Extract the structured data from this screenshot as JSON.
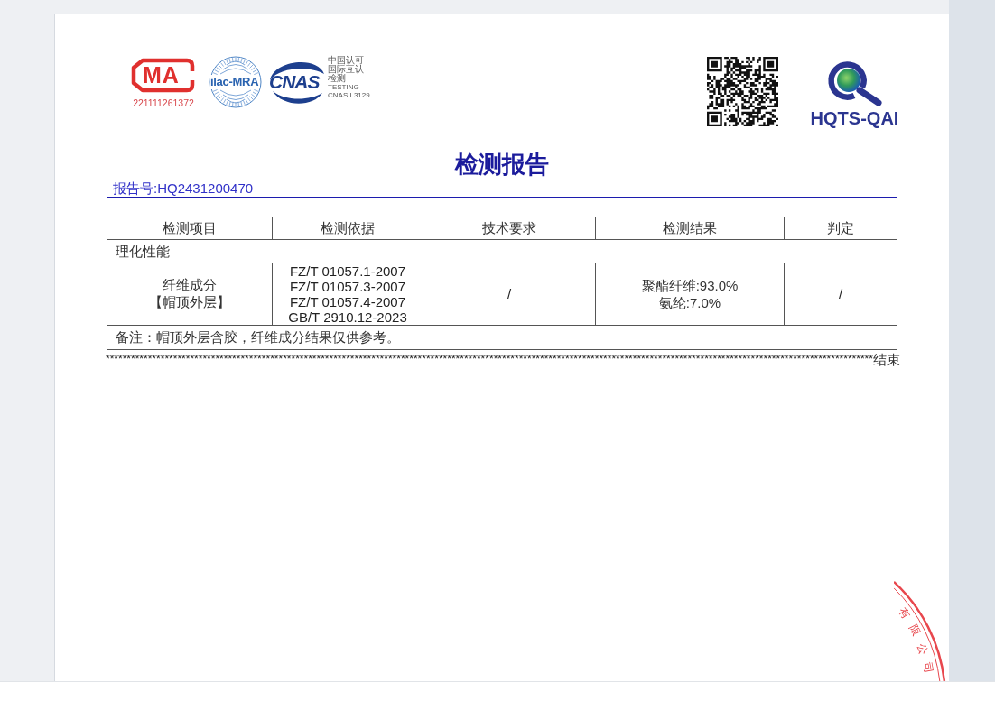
{
  "header": {
    "cma": {
      "mark": "MA",
      "number": "221111261372"
    },
    "ilac": {
      "mark": "ilac-MRA"
    },
    "cnas": {
      "mark": "CNAS",
      "caption_cn": [
        "中国认可",
        "国际互认",
        "检测"
      ],
      "caption_en": [
        "TESTING",
        "CNAS L3129"
      ]
    },
    "hqts": {
      "name": "HQTS-QAI"
    }
  },
  "title": "检测报告",
  "report_number": "报告号:HQ2431200470",
  "table": {
    "columns": [
      "检测项目",
      "检测依据",
      "技术要求",
      "检测结果",
      "判定"
    ],
    "section": "理化性能",
    "rows": [
      {
        "item": [
          "纤维成分",
          "【帽顶外层】"
        ],
        "basis": [
          "FZ/T 01057.1-2007",
          "FZ/T 01057.3-2007",
          "FZ/T 01057.4-2007",
          "GB/T 2910.12-2023"
        ],
        "requirement": "/",
        "result": [
          "聚酯纤维:93.0%",
          "氨纶:7.0%"
        ],
        "verdict": "/"
      }
    ],
    "remark": "备注：帽顶外层含胶，纤维成分结果仅供参考。"
  },
  "end_line": {
    "stars": "**************************************************************************************************************************************************************************************",
    "label": "结束"
  },
  "seal": {
    "text": "有限公司"
  }
}
